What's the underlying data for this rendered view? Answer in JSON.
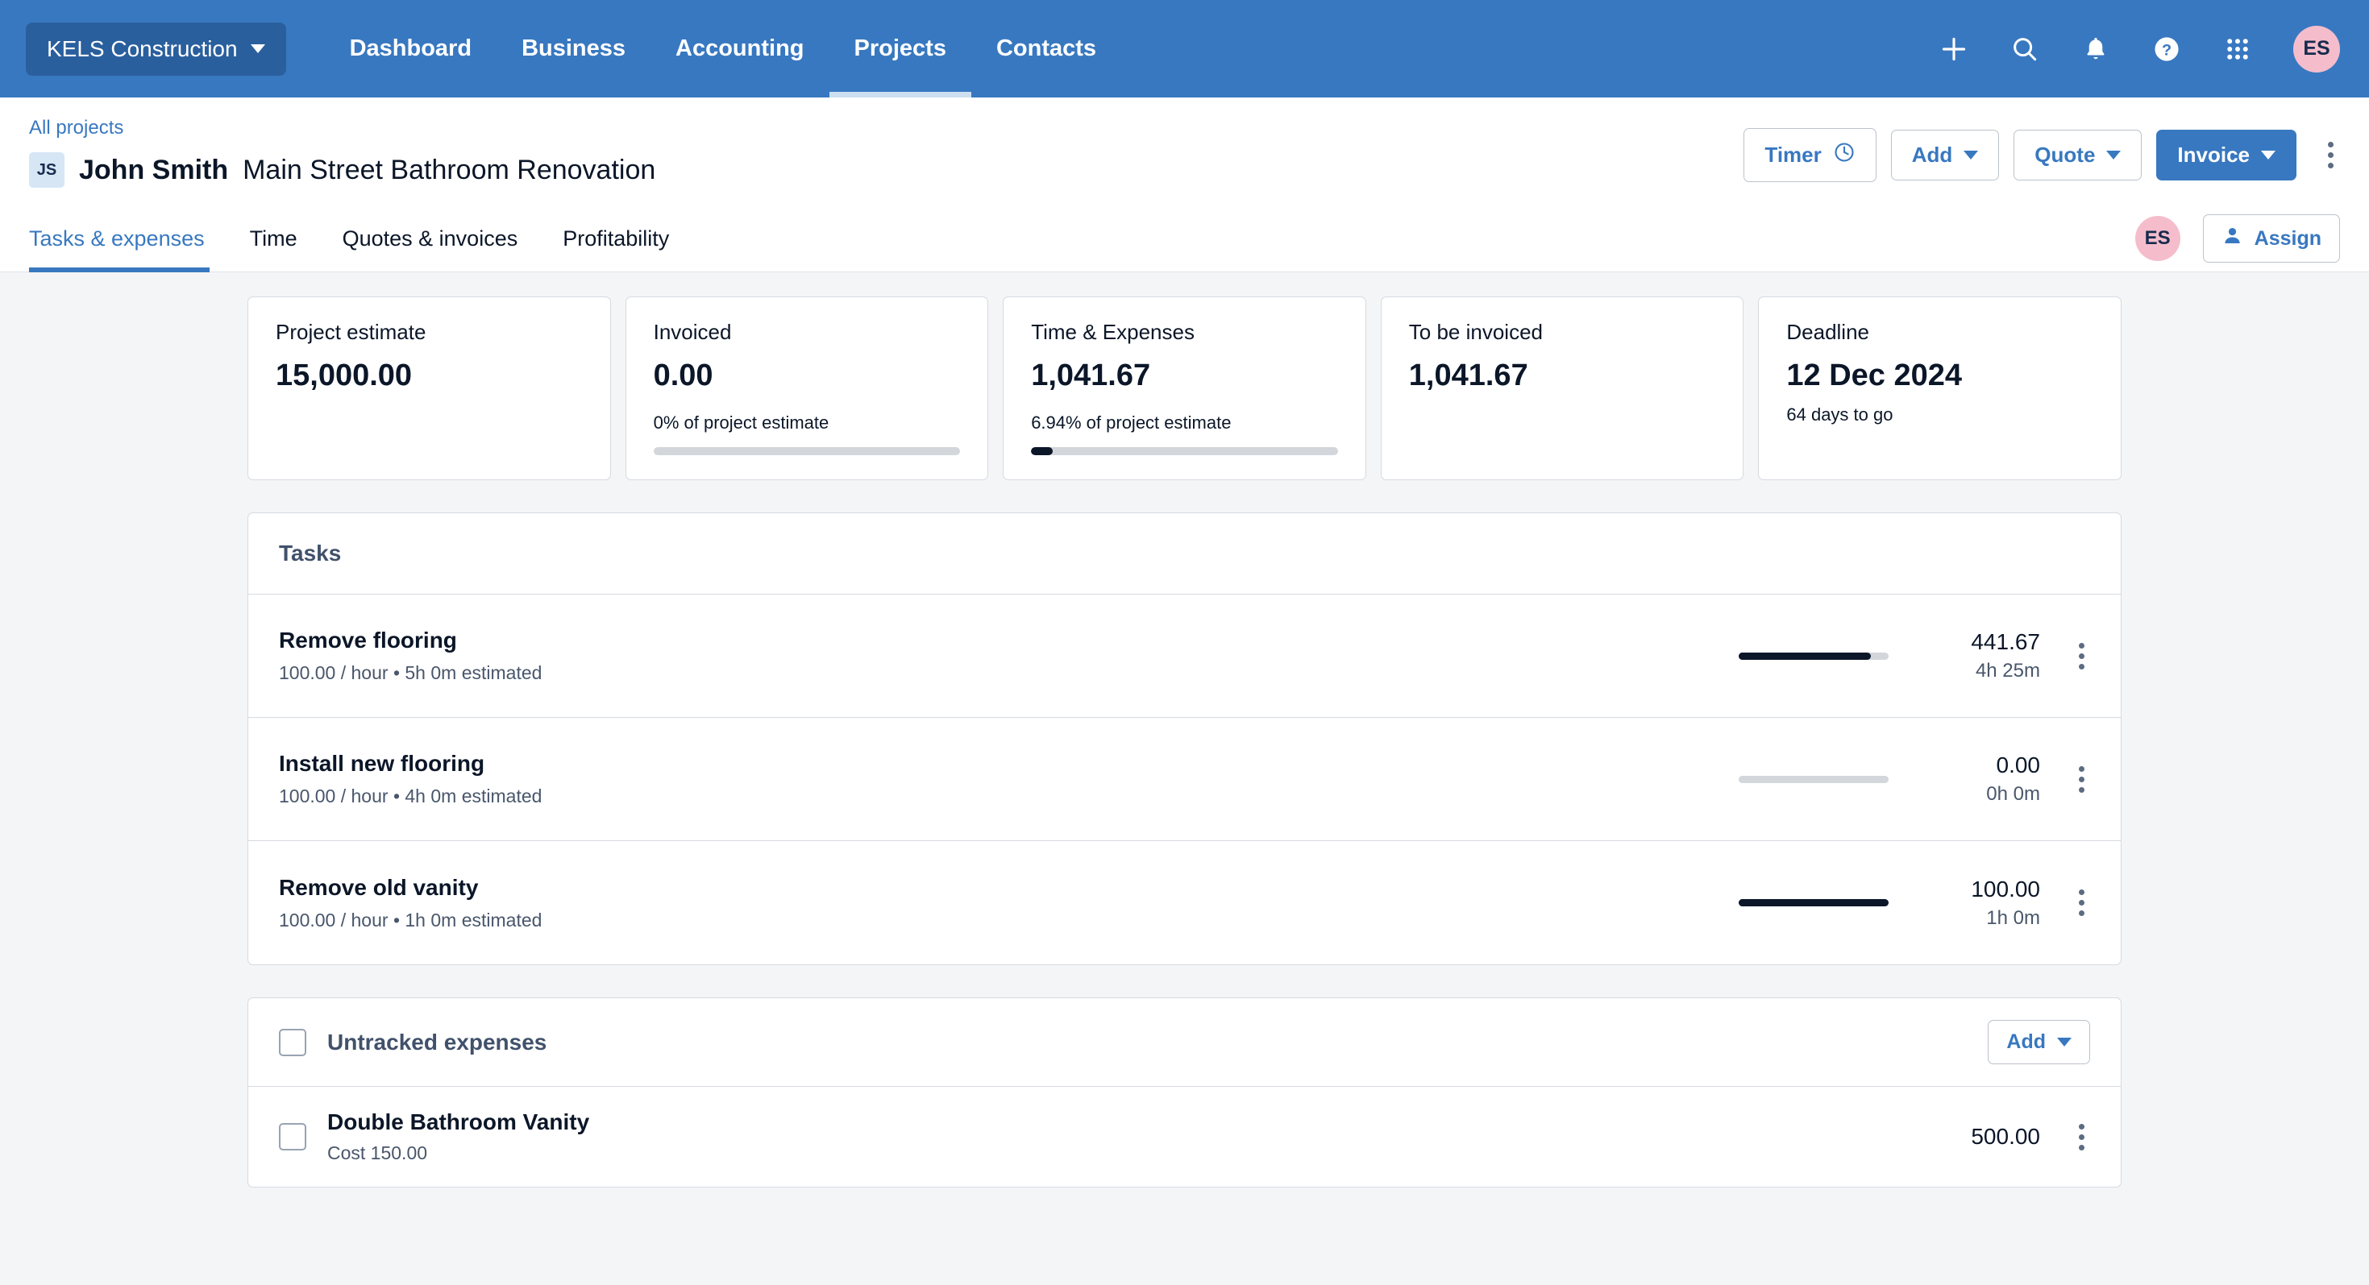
{
  "topnav": {
    "org": "KELS Construction",
    "links": [
      {
        "label": "Dashboard",
        "active": false
      },
      {
        "label": "Business",
        "active": false
      },
      {
        "label": "Accounting",
        "active": false
      },
      {
        "label": "Projects",
        "active": true
      },
      {
        "label": "Contacts",
        "active": false
      }
    ],
    "icons": [
      "plus-icon",
      "search-icon",
      "bell-icon",
      "help-icon",
      "apps-grid-icon"
    ],
    "avatar": "ES",
    "bg_color": "#3878c0",
    "org_pill_color": "#2a5f9e",
    "avatar_color": "#f5bdcc"
  },
  "project_header": {
    "breadcrumb": "All projects",
    "client_initials": "JS",
    "client_name": "John Smith",
    "project_name": "Main Street Bathroom Renovation",
    "buttons": {
      "timer": "Timer",
      "add": "Add",
      "quote": "Quote",
      "invoice": "Invoice"
    }
  },
  "tabs": [
    {
      "label": "Tasks & expenses",
      "active": true
    },
    {
      "label": "Time",
      "active": false
    },
    {
      "label": "Quotes & invoices",
      "active": false
    },
    {
      "label": "Profitability",
      "active": false
    }
  ],
  "tabbar_right": {
    "avatar": "ES",
    "assign_label": "Assign"
  },
  "cards": [
    {
      "label": "Project estimate",
      "value": "15,000.00",
      "sub": "",
      "progress": null
    },
    {
      "label": "Invoiced",
      "value": "0.00",
      "sub": "0% of project estimate",
      "progress": 0
    },
    {
      "label": "Time & Expenses",
      "value": "1,041.67",
      "sub": "6.94% of project estimate",
      "progress": 6.94
    },
    {
      "label": "To be invoiced",
      "value": "1,041.67",
      "sub": "",
      "progress": null
    },
    {
      "label": "Deadline",
      "value": "12 Dec 2024",
      "sub": "64 days to go",
      "progress": null
    }
  ],
  "tasks_panel": {
    "title": "Tasks",
    "rows": [
      {
        "title": "Remove flooring",
        "meta": "100.00 / hour • 5h 0m estimated",
        "progress": 88,
        "amount": "441.67",
        "time": "4h 25m"
      },
      {
        "title": "Install new flooring",
        "meta": "100.00 / hour • 4h 0m estimated",
        "progress": 0,
        "amount": "0.00",
        "time": "0h 0m"
      },
      {
        "title": "Remove old vanity",
        "meta": "100.00 / hour • 1h 0m estimated",
        "progress": 100,
        "amount": "100.00",
        "time": "1h 0m"
      }
    ]
  },
  "expenses_panel": {
    "title": "Untracked expenses",
    "add_label": "Add",
    "rows": [
      {
        "title": "Double Bathroom Vanity",
        "meta": "Cost 150.00",
        "amount": "500.00"
      }
    ]
  }
}
